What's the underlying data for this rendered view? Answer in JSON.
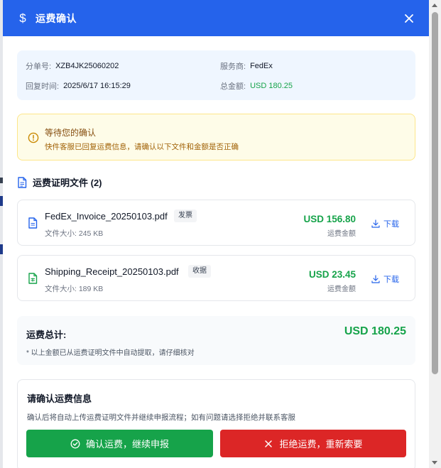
{
  "header": {
    "icon": "dollar-icon",
    "icon_glyph": "$",
    "title": "运费确认",
    "close_icon": "close-icon"
  },
  "info": {
    "order_no_label": "分单号:",
    "order_no": "XZB4JK25060202",
    "carrier_label": "服务商:",
    "carrier": "FedEx",
    "reply_time_label": "回复时间:",
    "reply_time": "2025/6/17 16:15:29",
    "total_label": "总金额:",
    "total": "USD 180.25"
  },
  "alert": {
    "icon": "alert-circle-icon",
    "title": "等待您的确认",
    "text": "快件客服已回复运费信息，请确认以下文件和金额是否正确"
  },
  "files_section": {
    "icon": "document-icon",
    "title": "运费证明文件 (2)"
  },
  "files": [
    {
      "icon": "file-text-icon",
      "icon_color": "#2563eb",
      "name": "FedEx_Invoice_20250103.pdf",
      "tag": "发票",
      "size": "文件大小: 245 KB",
      "amount": "USD 156.80",
      "amount_label": "运费金额",
      "download_label": "下载"
    },
    {
      "icon": "file-spreadsheet-icon",
      "icon_color": "#16a34a",
      "name": "Shipping_Receipt_20250103.pdf",
      "tag": "收据",
      "size": "文件大小: 189 KB",
      "amount": "USD 23.45",
      "amount_label": "运费金额",
      "download_label": "下载"
    }
  ],
  "summary": {
    "label": "运费总计:",
    "value": "USD 180.25",
    "note": "* 以上金额已从运费证明文件中自动提取，请仔细核对"
  },
  "confirm": {
    "title": "请确认运费信息",
    "text": "确认后将自动上传运费证明文件并继续申报流程；如有问题请选择拒绝并联系客服",
    "confirm_button": "确认运费，继续申报",
    "reject_button": "拒绝运费，重新索要"
  },
  "colors": {
    "primary": "#2563eb",
    "success": "#16a34a",
    "danger": "#dc2626",
    "warning_bg": "#fefce8"
  }
}
